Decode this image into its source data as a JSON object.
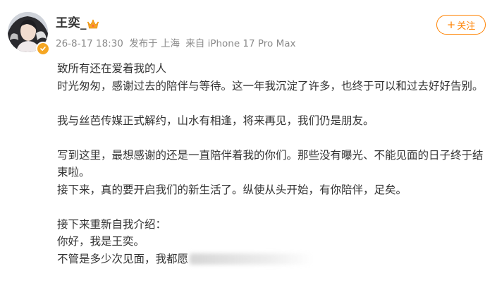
{
  "post": {
    "author": {
      "name": "王奕_",
      "avatar_icon": "avatar-portrait",
      "verified_icon": "verified-badge-icon",
      "badge_icon": "crown-badge-icon"
    },
    "meta": {
      "date": "26-8-17 18:30",
      "location": "发布于 上海",
      "device": "来自 iPhone 17 Pro Max"
    },
    "follow_label": "关注",
    "follow_plus": "+",
    "accent_color": "#ff8200",
    "paragraphs": [
      "致所有还在爱着我的人",
      "时光匆匆，感谢过去的陪伴与等待。这一年我沉淀了许多，也终于可以和过去好好告别。",
      "",
      "我与丝芭传媒正式解约，山水有相逢，将来再见，我们仍是朋友。",
      "",
      "写到这里，最想感谢的还是一直陪伴着我的你们。那些没有曝光、不能见面的日子终于结束啦。",
      "接下来，真的要开启我们的新生活了。纵使从头开始，有你陪伴，足矣。",
      "",
      "接下来重新自我介绍：",
      "你好，我是王奕。"
    ],
    "last_line_visible": "不管是多少次见面，我都愿"
  }
}
